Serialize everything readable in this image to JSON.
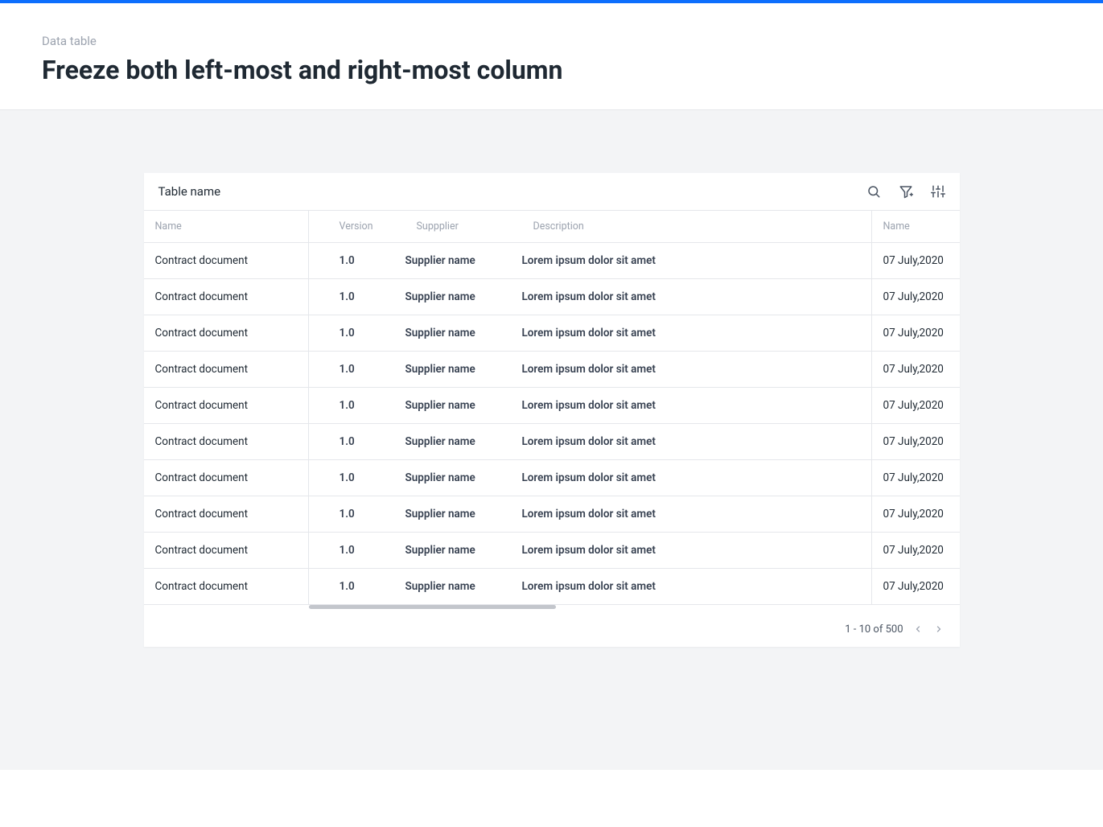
{
  "header": {
    "eyebrow": "Data table",
    "title": "Freeze both left-most and right-most column"
  },
  "table": {
    "title": "Table name",
    "columns": {
      "left": "Name",
      "version": "Version",
      "supplier": "Suppplier",
      "description": "Description",
      "right": "Name"
    },
    "rows": [
      {
        "name": "Contract document",
        "version": "1.0",
        "supplier": "Supplier name",
        "description": "Lorem ipsum dolor sit amet",
        "date": "07 July,2020"
      },
      {
        "name": "Contract document",
        "version": "1.0",
        "supplier": "Supplier name",
        "description": "Lorem ipsum dolor sit amet",
        "date": "07 July,2020"
      },
      {
        "name": "Contract document",
        "version": "1.0",
        "supplier": "Supplier name",
        "description": "Lorem ipsum dolor sit amet",
        "date": "07 July,2020"
      },
      {
        "name": "Contract document",
        "version": "1.0",
        "supplier": "Supplier name",
        "description": "Lorem ipsum dolor sit amet",
        "date": "07 July,2020"
      },
      {
        "name": "Contract document",
        "version": "1.0",
        "supplier": "Supplier name",
        "description": "Lorem ipsum dolor sit amet",
        "date": "07 July,2020"
      },
      {
        "name": "Contract document",
        "version": "1.0",
        "supplier": "Supplier name",
        "description": "Lorem ipsum dolor sit amet",
        "date": "07 July,2020"
      },
      {
        "name": "Contract document",
        "version": "1.0",
        "supplier": "Supplier name",
        "description": "Lorem ipsum dolor sit amet",
        "date": "07 July,2020"
      },
      {
        "name": "Contract document",
        "version": "1.0",
        "supplier": "Supplier name",
        "description": "Lorem ipsum dolor sit amet",
        "date": "07 July,2020"
      },
      {
        "name": "Contract document",
        "version": "1.0",
        "supplier": "Supplier name",
        "description": "Lorem ipsum dolor sit amet",
        "date": "07 July,2020"
      },
      {
        "name": "Contract document",
        "version": "1.0",
        "supplier": "Supplier name",
        "description": "Lorem ipsum dolor sit amet",
        "date": "07 July,2020"
      }
    ],
    "pager": {
      "range": "1 - 10 of 500"
    }
  }
}
